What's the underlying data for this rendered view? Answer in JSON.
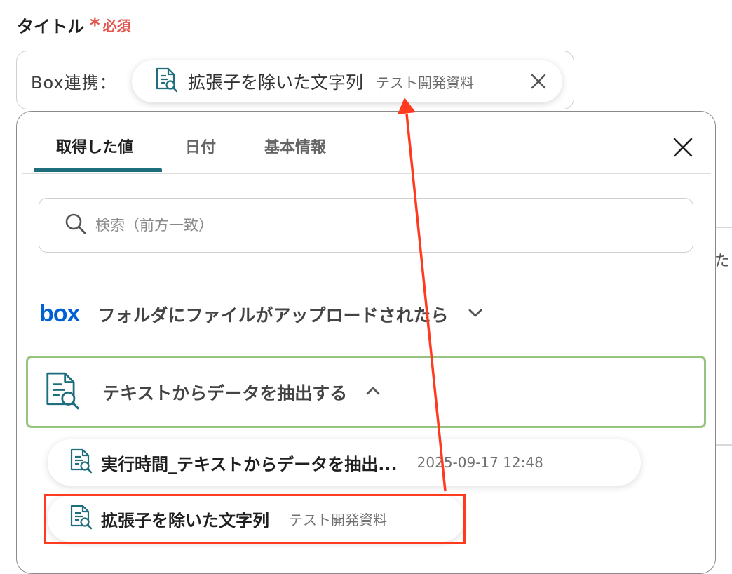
{
  "field": {
    "title": "タイトル",
    "required_mark": "*",
    "required_label": "必須",
    "prefix": "Box連携：",
    "chip": {
      "label": "拡張子を除いた文字列",
      "source": "テスト開発資料"
    }
  },
  "panel": {
    "tabs": [
      {
        "label": "取得した値",
        "active": true
      },
      {
        "label": "日付",
        "active": false
      },
      {
        "label": "基本情報",
        "active": false
      }
    ],
    "search_placeholder": "検索（前方一致）",
    "box_section": {
      "logo_text": "box",
      "label": "フォルダにファイルがアップロードされたら"
    },
    "extract_section": {
      "label": "テキストからデータを抽出する",
      "items": [
        {
          "label": "実行時間_テキストからデータを抽出...",
          "value": "2025-09-17 12:48"
        },
        {
          "label": "拡張子を除いた文字列",
          "value": "テスト開発資料"
        }
      ]
    }
  },
  "background": {
    "partial_text": "た"
  },
  "colors": {
    "required": "#e2564f",
    "tab_underline": "#1e6e7e",
    "section_border": "#96c47e",
    "annotation": "#ff3b1f",
    "box_brand": "#0061d5",
    "doc_icon": "#1e6e7e"
  },
  "icons": {
    "document_search": "doc-search-icon",
    "close": "close-icon",
    "search": "search-icon",
    "chevron_down": "chevron-down-icon",
    "chevron_up": "chevron-up-icon"
  }
}
